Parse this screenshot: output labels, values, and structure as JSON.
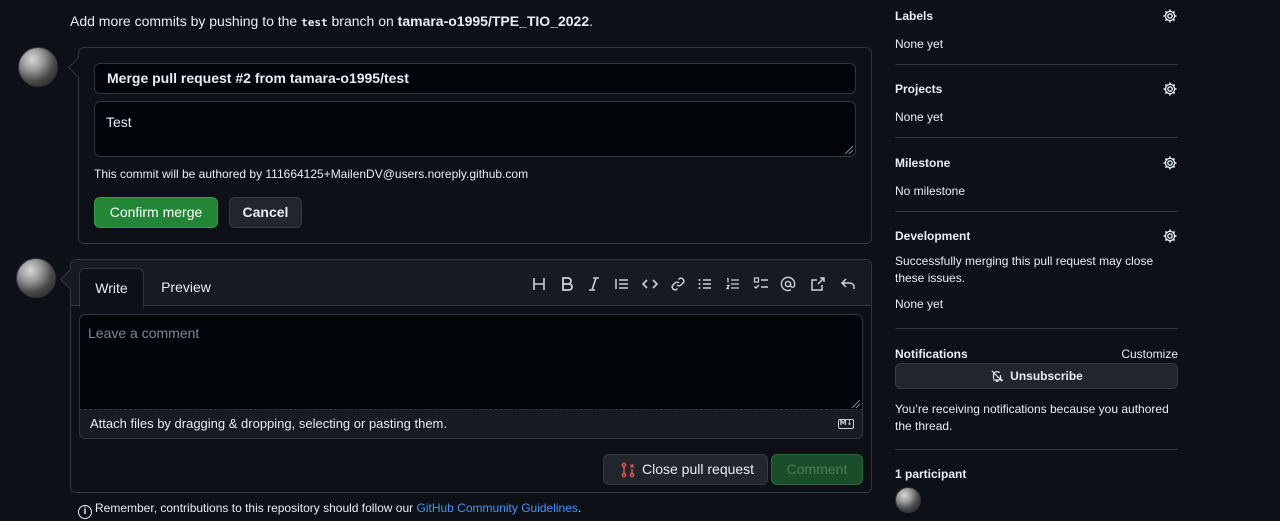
{
  "push_hint": {
    "prefix": "Add more commits by pushing to the ",
    "branch": "test",
    "middle": " branch on ",
    "repo": "tamara-o1995/TPE_TIO_2022",
    "suffix": "."
  },
  "merge": {
    "title_value": "Merge pull request #2 from tamara-o1995/test",
    "body_value": "Test",
    "author_note": "This commit will be authored by 111664125+MailenDV@users.noreply.github.com",
    "confirm_label": "Confirm merge",
    "cancel_label": "Cancel"
  },
  "comment": {
    "tabs": [
      "Write",
      "Preview"
    ],
    "toolbar": [
      "heading-icon",
      "bold-icon",
      "italic-icon",
      "quote-icon",
      "code-icon",
      "link-icon",
      "unordered-list-icon",
      "ordered-list-icon",
      "task-list-icon",
      "mention-icon",
      "reference-icon",
      "reply-icon"
    ],
    "placeholder": "Leave a comment",
    "attach_hint": "Attach files by dragging & dropping, selecting or pasting them.",
    "close_pr_label": "Close pull request",
    "comment_label": "Comment"
  },
  "guidelines": {
    "text": "Remember, contributions to this repository should follow our ",
    "link": "GitHub Community Guidelines",
    "suffix": "."
  },
  "sidebar": {
    "labels": {
      "title": "Labels",
      "value": "None yet"
    },
    "projects": {
      "title": "Projects",
      "value": "None yet"
    },
    "milestone": {
      "title": "Milestone",
      "value": "No milestone"
    },
    "development": {
      "title": "Development",
      "description": "Successfully merging this pull request may close these issues.",
      "value": "None yet"
    },
    "notifications": {
      "title": "Notifications",
      "customize": "Customize",
      "unsubscribe": "Unsubscribe",
      "note": "You’re receiving notifications because you authored the thread."
    },
    "participants": {
      "title": "1 participant"
    }
  },
  "colors": {
    "background": "#0d1117",
    "accent_green": "#238636",
    "link_blue": "#4493f8",
    "close_red": "#f85149"
  }
}
